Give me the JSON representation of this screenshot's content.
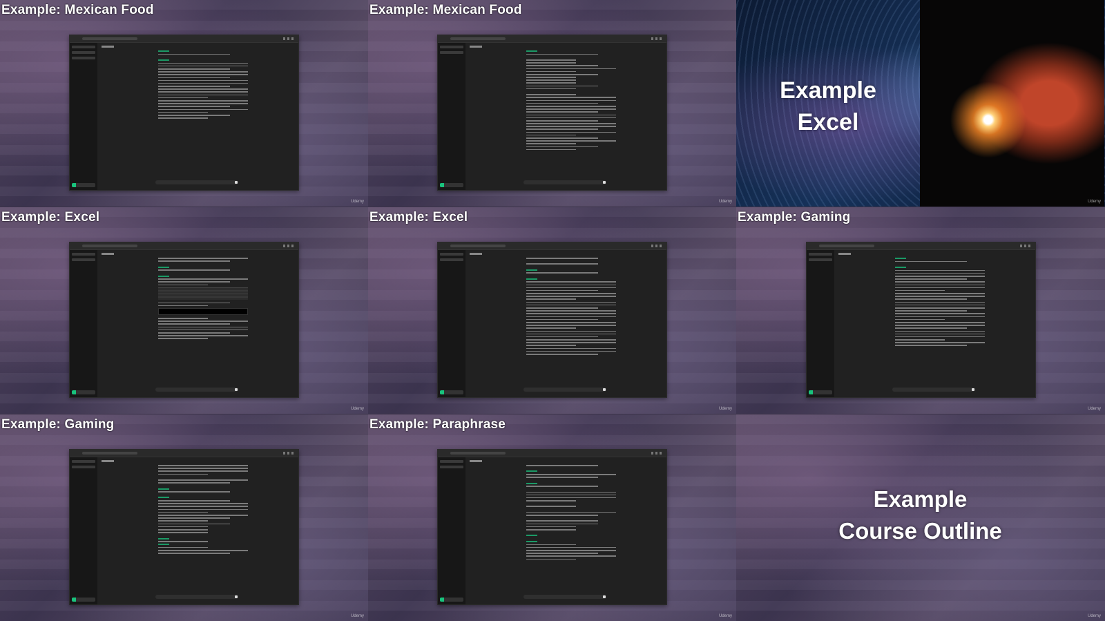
{
  "tiles": [
    {
      "title": "Example: Mexican Food",
      "watermark": "Udemy"
    },
    {
      "title": "Example: Mexican Food",
      "watermark": "Udemy"
    },
    {
      "overlay_line1": "Example",
      "overlay_line2": "Excel",
      "watermark": "Udemy"
    },
    {
      "title": "Example: Excel",
      "watermark": "Udemy"
    },
    {
      "title": "Example: Excel",
      "watermark": "Udemy"
    },
    {
      "title": "Example: Gaming",
      "watermark": "Udemy"
    },
    {
      "title": "Example: Gaming",
      "watermark": "Udemy"
    },
    {
      "title": "Example: Paraphrase",
      "watermark": "Udemy"
    },
    {
      "overlay_line1": "Example",
      "overlay_line2": "Course Outline",
      "watermark": "Udemy"
    }
  ]
}
